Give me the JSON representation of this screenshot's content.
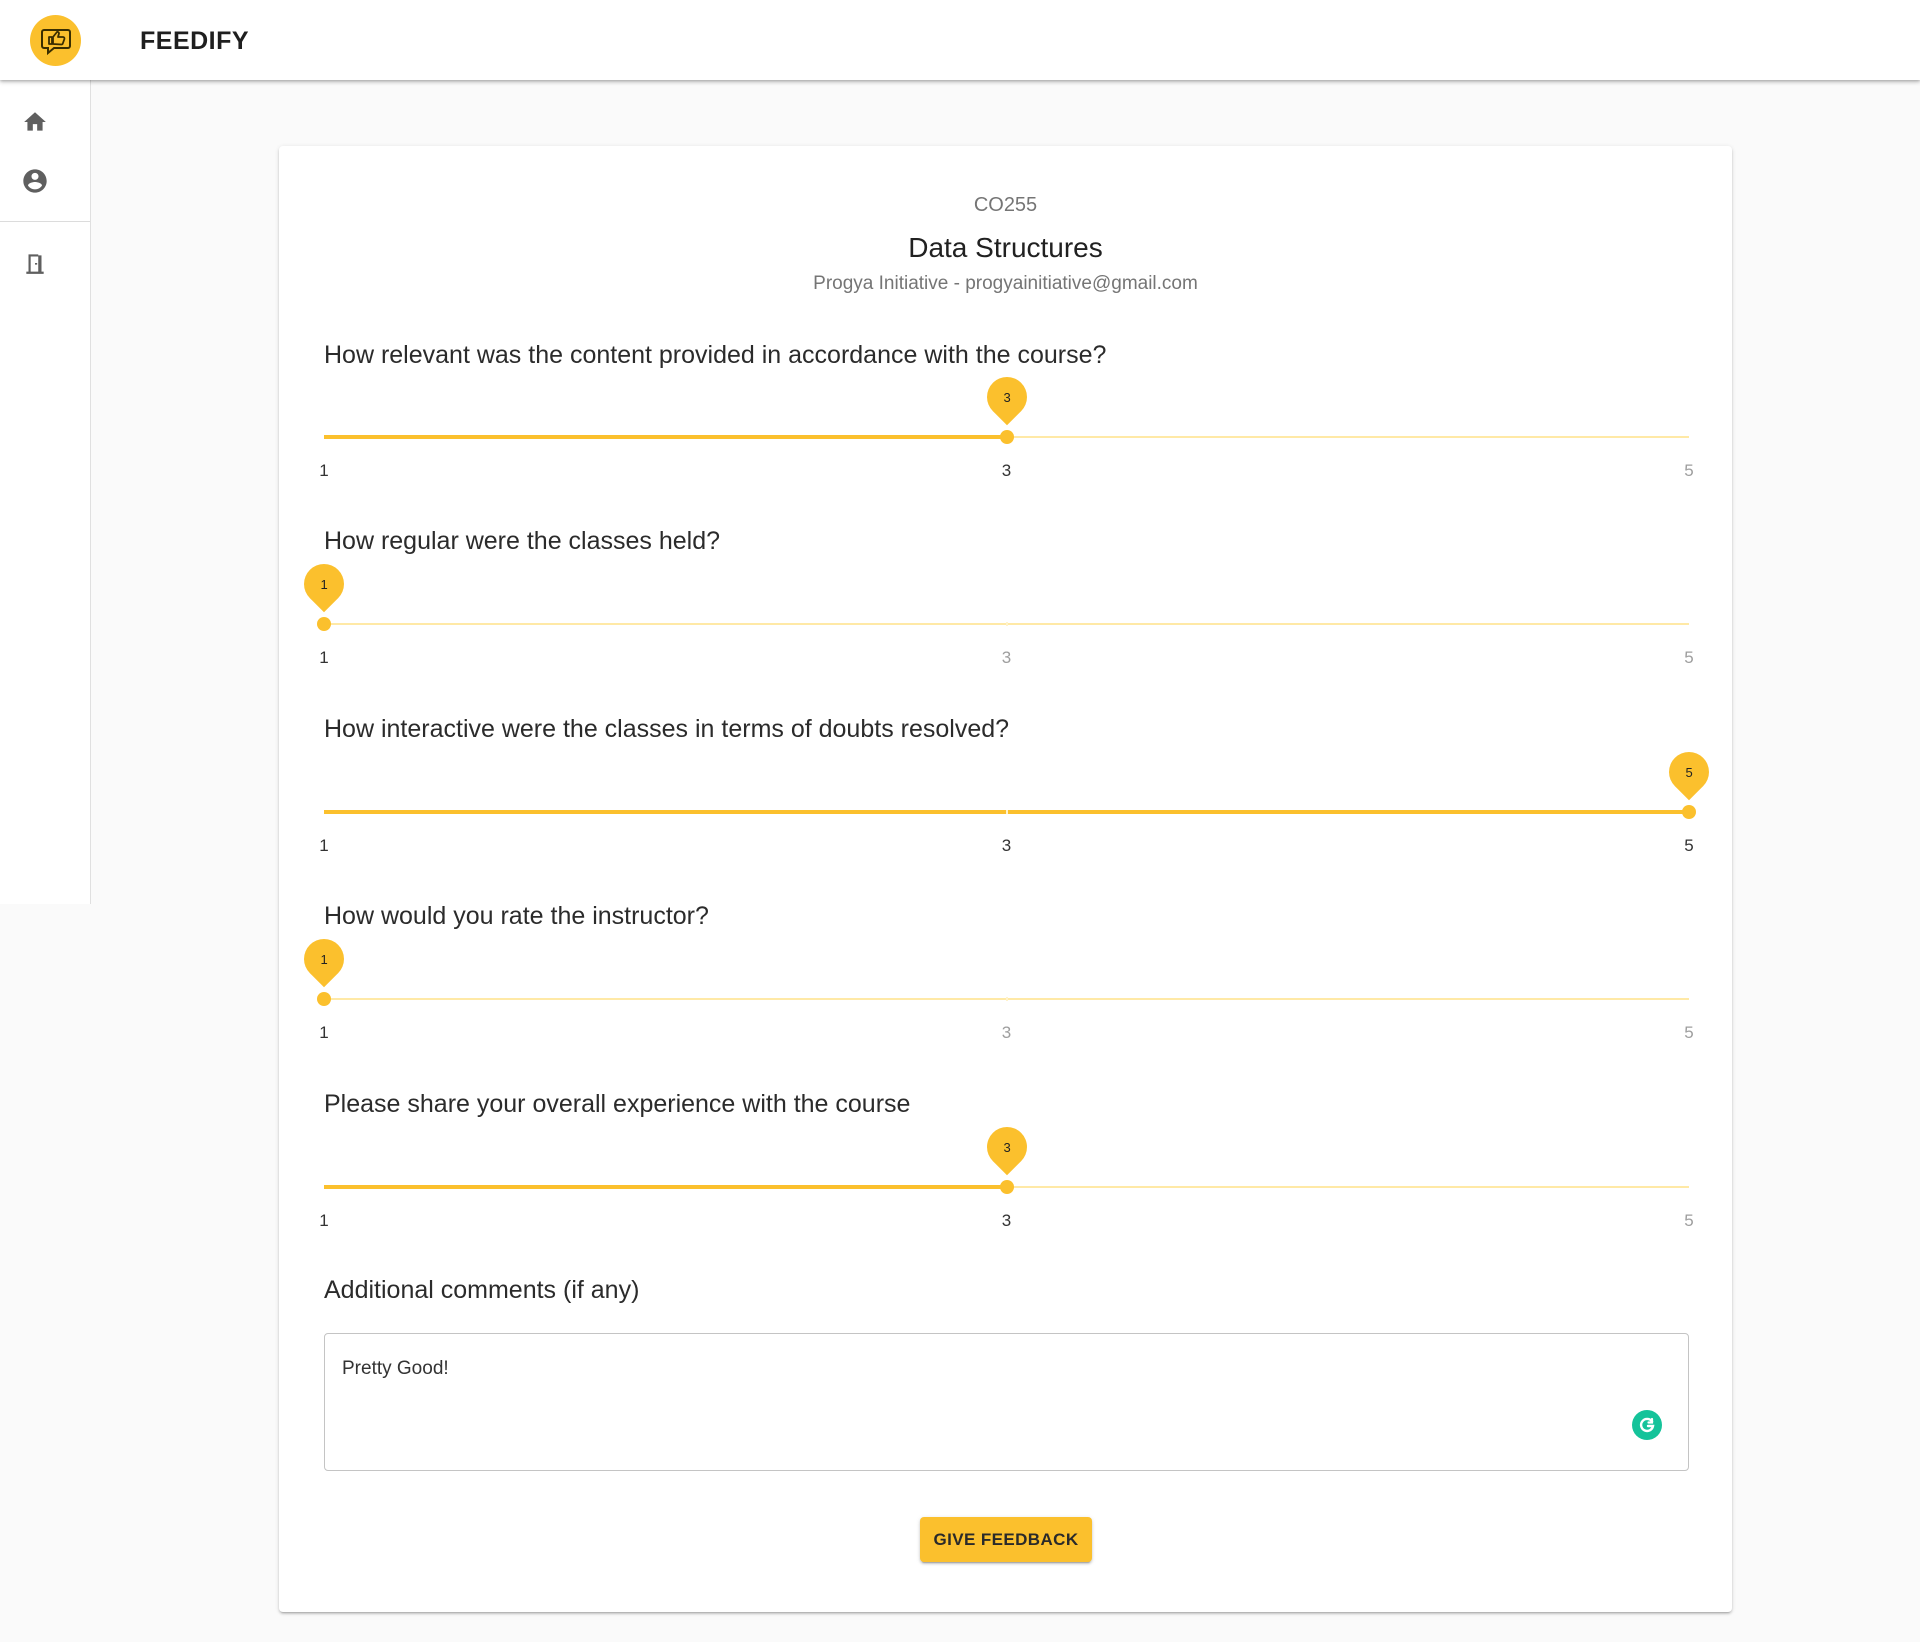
{
  "app": {
    "title": "FEEDIFY",
    "logo_icon": "thumbs-up-chat-icon",
    "accent": "#fbc02d"
  },
  "nav": {
    "items": [
      {
        "icon": "home-icon"
      },
      {
        "icon": "account-circle-icon"
      },
      {
        "icon": "exit-door-icon"
      }
    ]
  },
  "course": {
    "code": "CO255",
    "name": "Data Structures",
    "meta": "Progya Initiative - progyainitiative@gmail.com"
  },
  "questions": [
    {
      "text": "How relevant was the content provided in accordance with the course?",
      "value": 3
    },
    {
      "text": "How regular were the classes held?",
      "value": 1
    },
    {
      "text": "How interactive were the classes in terms of doubts resolved?",
      "value": 5
    },
    {
      "text": "How would you rate the instructor?",
      "value": 1
    },
    {
      "text": "Please share your overall experience with the course",
      "value": 3
    }
  ],
  "scale": {
    "min": 1,
    "max": 5,
    "marks": [
      "1",
      "3",
      "5"
    ]
  },
  "comments": {
    "label": "Additional comments (if any)",
    "value": "Pretty Good!",
    "grammarly_icon": "grammarly-icon"
  },
  "submit": {
    "label": "GIVE FEEDBACK"
  }
}
